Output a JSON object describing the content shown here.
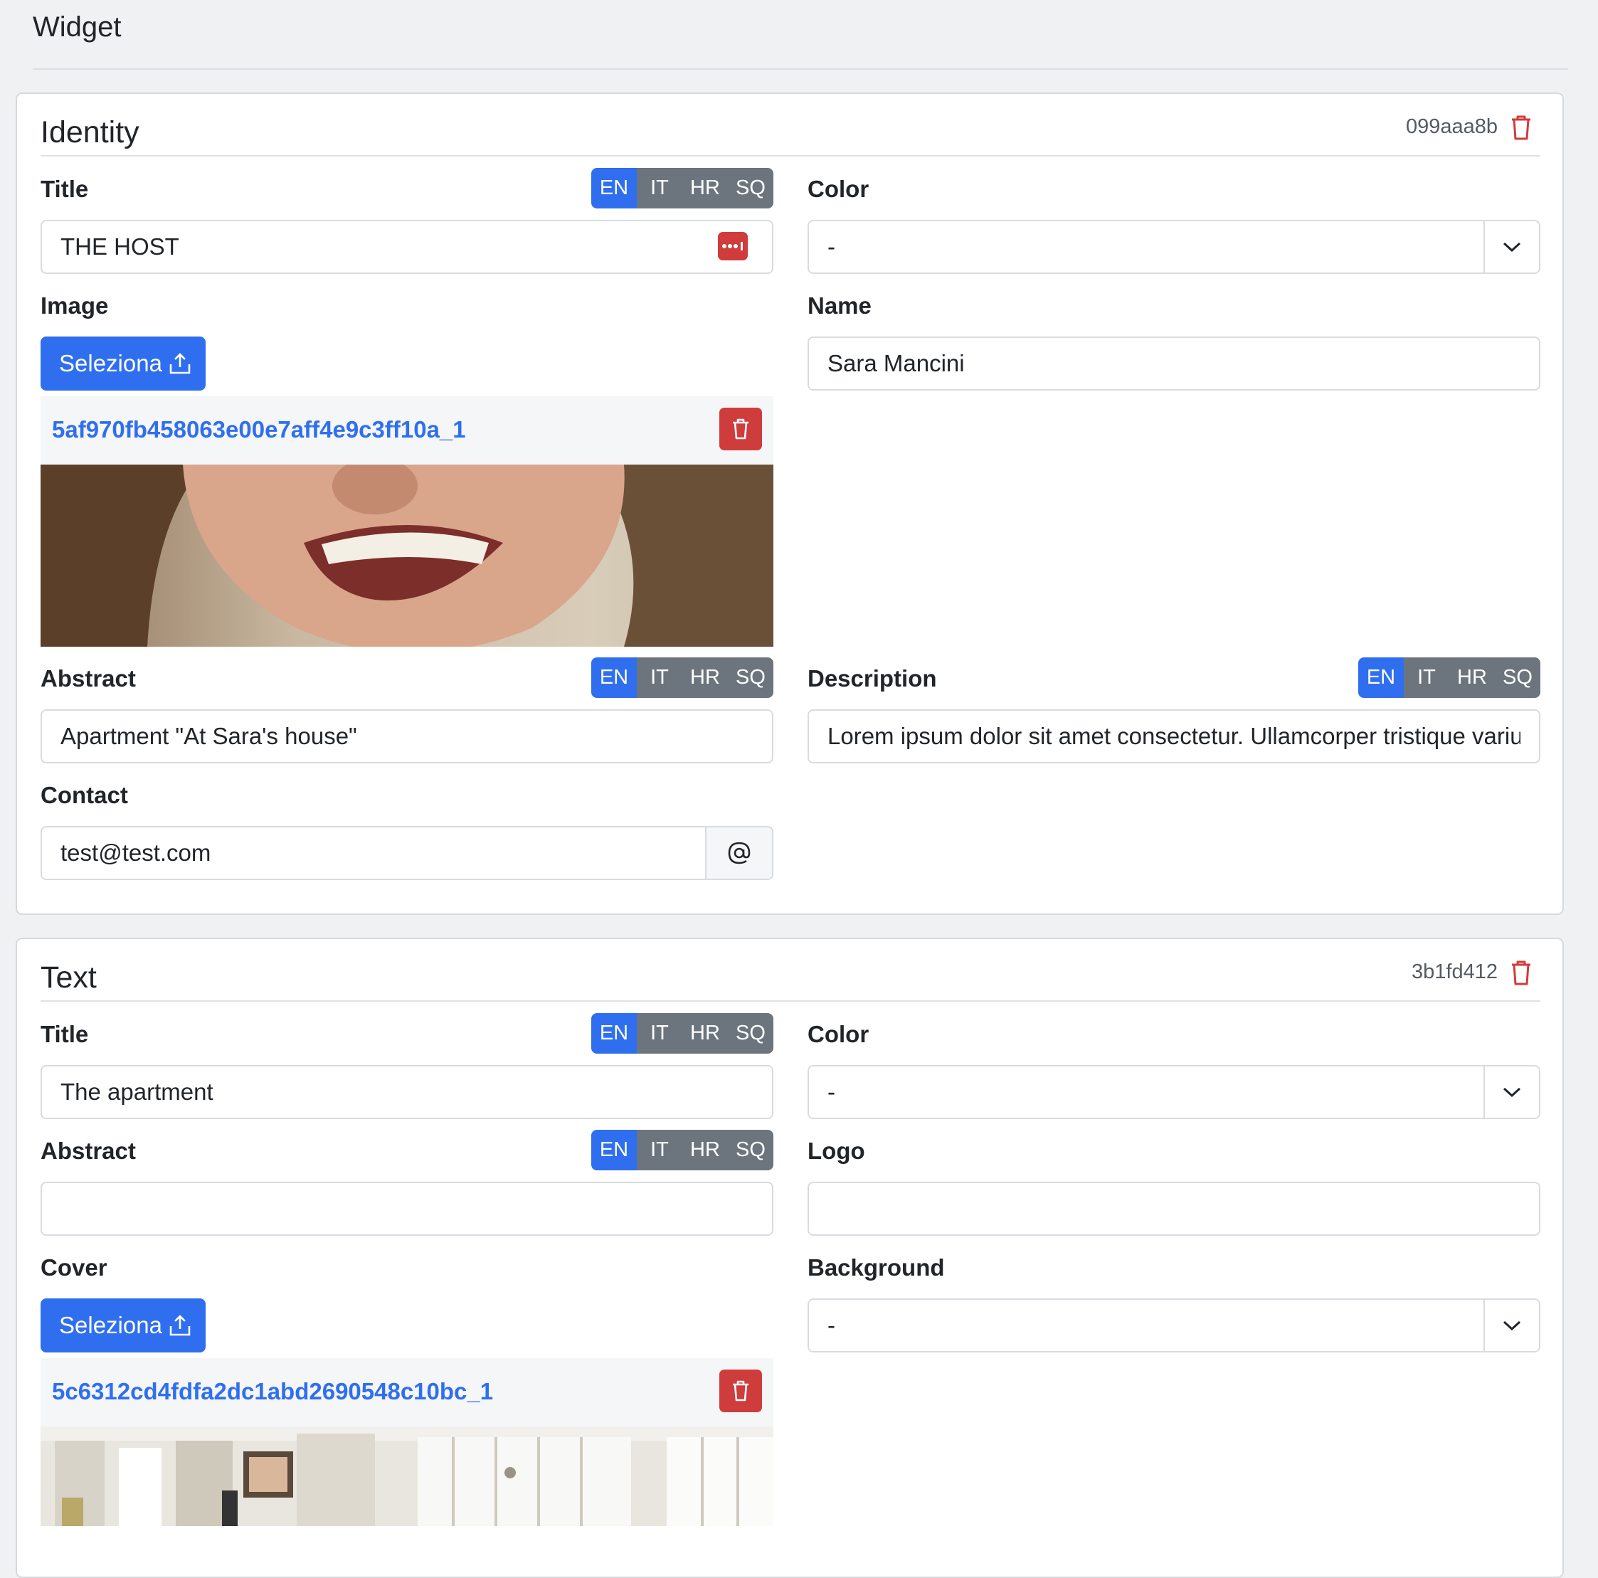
{
  "page": {
    "title": "Widget"
  },
  "languages": [
    "EN",
    "IT",
    "HR",
    "SQ"
  ],
  "identity": {
    "heading": "Identity",
    "id": "099aaa8b",
    "title_label": "Title",
    "title_value": "THE HOST",
    "color_label": "Color",
    "color_value": "-",
    "image_label": "Image",
    "select_label": "Seleziona",
    "image_file": "5af970fb458063e00e7aff4e9c3ff10a_1",
    "name_label": "Name",
    "name_value": "Sara Mancini",
    "abstract_label": "Abstract",
    "abstract_value": "Apartment \"At Sara's house\"",
    "description_label": "Description",
    "description_value": "Lorem ipsum dolor sit amet consectetur. Ullamcorper tristique varius",
    "contact_label": "Contact",
    "contact_value": "test@test.com"
  },
  "text": {
    "heading": "Text",
    "id": "3b1fd412",
    "title_label": "Title",
    "title_value": "The apartment",
    "color_label": "Color",
    "color_value": "-",
    "abstract_label": "Abstract",
    "abstract_value": "",
    "logo_label": "Logo",
    "logo_value": "",
    "cover_label": "Cover",
    "select_label": "Seleziona",
    "cover_file": "5c6312cd4fdfa2dc1abd2690548c10bc_1",
    "background_label": "Background",
    "background_value": "-"
  },
  "colors": {
    "primary": "#2f6fef",
    "danger": "#cf3c3c",
    "secondary": "#6c757d"
  }
}
